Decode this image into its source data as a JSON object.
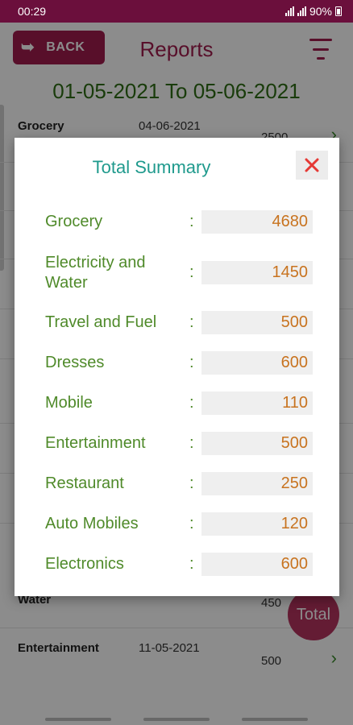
{
  "status_bar": {
    "time": "00:29",
    "battery": "90%"
  },
  "header": {
    "back_label": "BACK",
    "title": "Reports"
  },
  "date_range": "01-05-2021 To 05-06-2021",
  "background_list": [
    {
      "category": "Grocery",
      "date": "04-06-2021",
      "amount": "2500"
    },
    {
      "category": "Water",
      "date": "",
      "amount": "450"
    },
    {
      "category": "Entertainment",
      "date": "11-05-2021",
      "amount": "500"
    }
  ],
  "fab": {
    "label": "Total"
  },
  "dialog": {
    "title": "Total Summary",
    "separator": ":",
    "rows": [
      {
        "label": "Grocery",
        "value": "4680"
      },
      {
        "label": "Electricity and Water",
        "value": "1450"
      },
      {
        "label": "Travel and Fuel",
        "value": "500"
      },
      {
        "label": "Dresses",
        "value": "600"
      },
      {
        "label": "Mobile",
        "value": "110"
      },
      {
        "label": "Entertainment",
        "value": "500"
      },
      {
        "label": "Restaurant",
        "value": "250"
      },
      {
        "label": "Auto Mobiles",
        "value": "120"
      },
      {
        "label": "Electronics",
        "value": "600"
      }
    ]
  },
  "colors": {
    "primary": "#a01c4e",
    "status_bar": "#6b0f3c",
    "date_green": "#2f6e15",
    "title_teal": "#1f9a8d",
    "label_green": "#4f8a2a",
    "value_orange": "#c8731f",
    "close_red": "#e53935"
  },
  "icons": {
    "back": "back-arrow-icon",
    "filter": "filter-icon",
    "close": "close-icon",
    "chevron": "chevron-right-icon"
  }
}
